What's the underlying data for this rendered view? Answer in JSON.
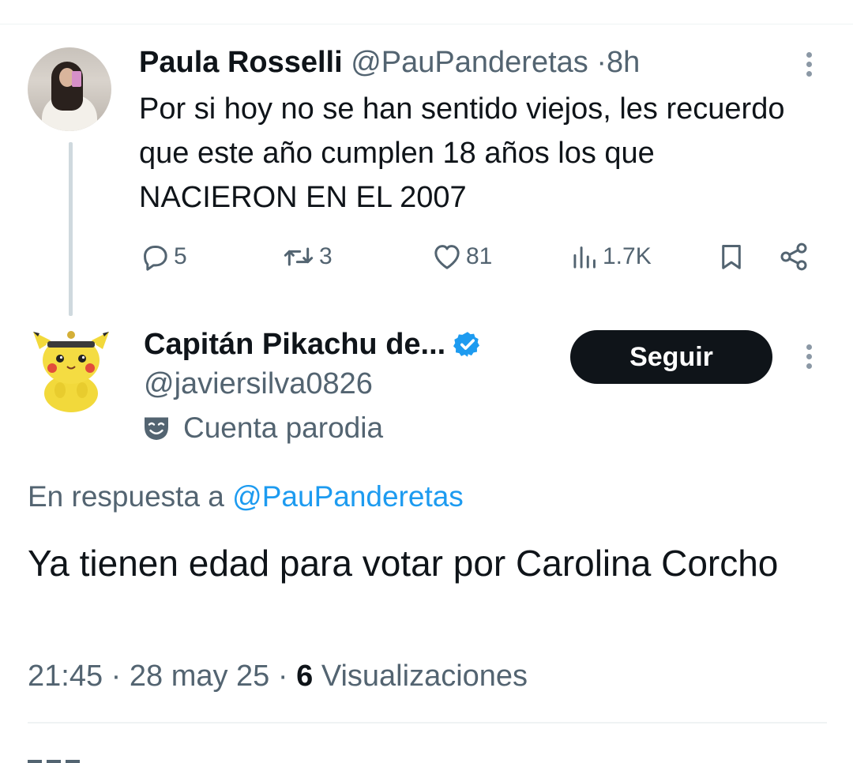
{
  "parent_tweet": {
    "author_name": "Paula Rosselli",
    "handle": "@PauPanderetas",
    "separator": "·",
    "time": "8h",
    "text": "Por si hoy no se han sentido viejos, les recuerdo que este año cumplen 18 años los que NACIERON EN EL 2007",
    "actions": {
      "replies": "5",
      "retweets": "3",
      "likes": "81",
      "views": "1.7K"
    }
  },
  "reply_tweet": {
    "author_name": "Capitán Pikachu de...",
    "handle": "@javiersilva0826",
    "parody_label": "Cuenta parodia",
    "follow_label": "Seguir",
    "in_reply_prefix": "En respuesta a",
    "in_reply_handle": "@PauPanderetas",
    "text": "Ya tienen edad para votar por Carolina Corcho",
    "time": "21:45",
    "separator": "·",
    "date": "28 may 25",
    "views_count": "6",
    "views_label": "Visualizaciones"
  },
  "colors": {
    "text_primary": "#0f1419",
    "text_secondary": "#536471",
    "link": "#1d9bf0",
    "verified": "#1d9bf0",
    "follow_bg": "#0f1419"
  },
  "icons": {
    "reply": "reply-icon",
    "retweet": "retweet-icon",
    "like": "heart-icon",
    "views": "analytics-icon",
    "bookmark": "bookmark-icon",
    "share": "share-icon",
    "more": "more-icon",
    "verified": "verified-badge-icon",
    "parody": "parody-mask-icon"
  }
}
